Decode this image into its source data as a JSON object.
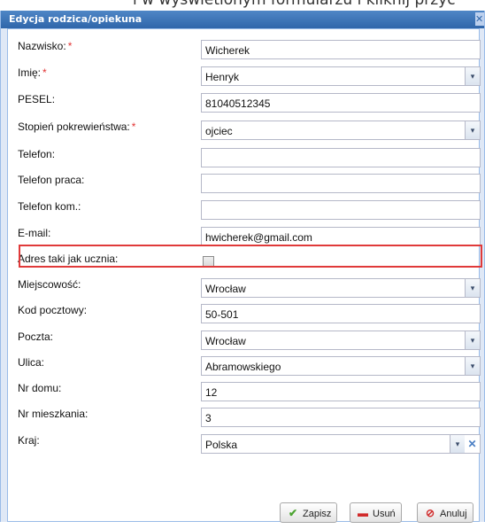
{
  "background_text": "i w wyświetlonym formularzu i kliknij przyc",
  "dialog": {
    "title": "Edycja rodzica/opiekuna",
    "close_glyph": "✕"
  },
  "fields": [
    {
      "label": "Nazwisko:",
      "required": "*",
      "value": "Wicherek",
      "type": "text"
    },
    {
      "label": "Imię:",
      "required": "*",
      "value": "Henryk",
      "type": "select"
    },
    {
      "label": "PESEL:",
      "required": "",
      "value": "81040512345",
      "type": "text"
    },
    {
      "label": "Stopień pokrewieństwa:",
      "required": "*",
      "value": "ojciec",
      "type": "select"
    },
    {
      "label": "Telefon:",
      "required": "",
      "value": "",
      "type": "text"
    },
    {
      "label": "Telefon praca:",
      "required": "",
      "value": "",
      "type": "text"
    },
    {
      "label": "Telefon kom.:",
      "required": "",
      "value": "",
      "type": "text"
    },
    {
      "label": "E-mail:",
      "required": "",
      "value": "hwicherek@gmail.com",
      "type": "text"
    },
    {
      "label": "Adres taki jak ucznia:",
      "required": "",
      "value": "",
      "type": "checkbox"
    },
    {
      "label": "Miejscowość:",
      "required": "",
      "value": "Wrocław",
      "type": "select"
    },
    {
      "label": "Kod pocztowy:",
      "required": "",
      "value": "50-501",
      "type": "text"
    },
    {
      "label": "Poczta:",
      "required": "",
      "value": "Wrocław",
      "type": "select"
    },
    {
      "label": "Ulica:",
      "required": "",
      "value": "Abramowskiego",
      "type": "select"
    },
    {
      "label": "Nr domu:",
      "required": "",
      "value": "12",
      "type": "text"
    },
    {
      "label": "Nr mieszkania:",
      "required": "",
      "value": "3",
      "type": "text"
    },
    {
      "label": "Kraj:",
      "required": "",
      "value": "Polska",
      "type": "select-clear"
    }
  ],
  "buttons": {
    "save": "Zapisz",
    "delete": "Usuń",
    "cancel": "Anuluj"
  },
  "icons": {
    "dropdown": "▾",
    "clear": "✕",
    "save": "✔",
    "delete": "▬",
    "cancel": "⊘"
  },
  "colors": {
    "title_bar": "#3a72b8",
    "highlight": "#e03a3a",
    "required": "#e23333"
  }
}
